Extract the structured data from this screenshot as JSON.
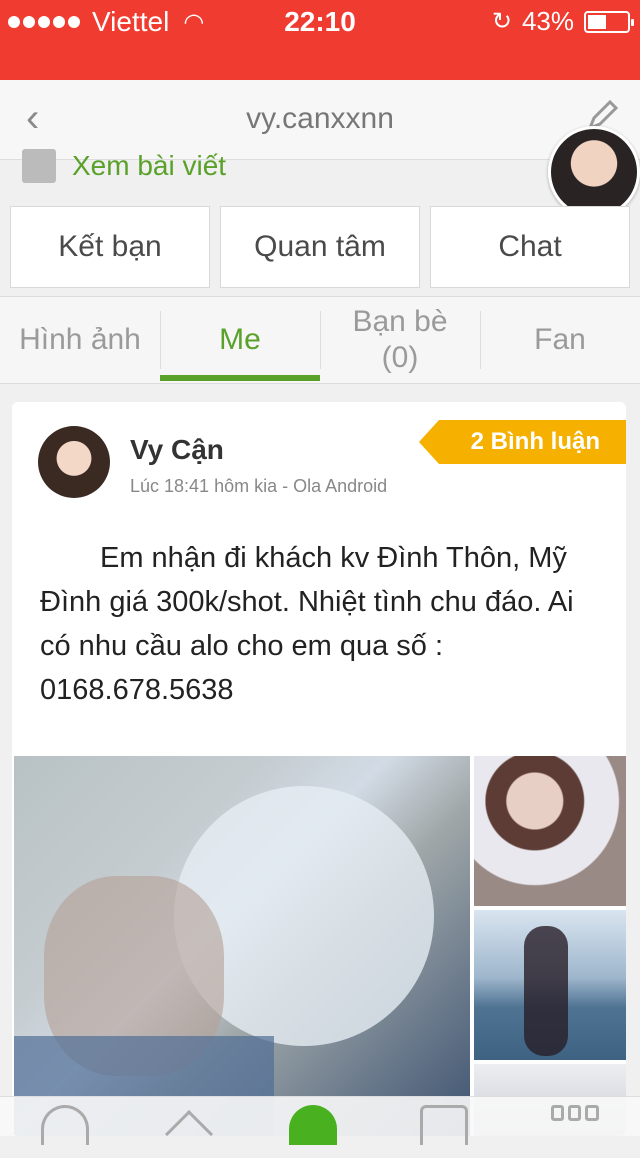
{
  "status_bar": {
    "carrier": "Viettel",
    "time": "22:10",
    "battery": "43%",
    "battery_level": 0.43
  },
  "nav": {
    "back_icon": "chevron-left-icon",
    "title": "vy.canxxnn",
    "edit_icon": "pencil-icon"
  },
  "profile": {
    "view_posts": "Xem bài viết"
  },
  "actions": {
    "add_friend": "Kết bạn",
    "follow": "Quan tâm",
    "chat": "Chat"
  },
  "tabs": {
    "photos": "Hình ảnh",
    "me": "Me",
    "friends": "Bạn bè",
    "friends_count": "(0)",
    "fans": "Fan"
  },
  "post": {
    "author": "Vy Cận",
    "meta": "Lúc 18:41 hôm kia - Ola Android",
    "comments_badge": "2 Bình luận",
    "content": "Em nhận đi khách kv Đình Thôn, Mỹ Đình giá 300k/shot. Nhiệt tình chu đáo. Ai có nhu cầu alo cho em qua số : 0168.678.5638"
  },
  "colors": {
    "status_bar": "#f03b30",
    "accent_green": "#5aa12a",
    "badge": "#f6b000"
  }
}
